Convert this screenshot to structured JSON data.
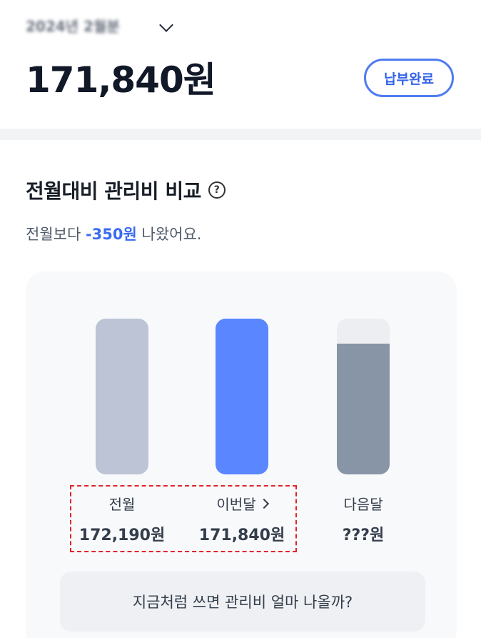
{
  "header": {
    "period_label": "2024년 2월분",
    "total_amount": "171,840원",
    "status_badge": "납부완료"
  },
  "comparison": {
    "title": "전월대비 관리비 비교",
    "subtitle_prefix": "전월보다 ",
    "subtitle_diff": "-350원",
    "subtitle_suffix": " 나왔어요."
  },
  "chart_data": {
    "type": "bar",
    "categories": [
      "전월",
      "이번달",
      "다음달"
    ],
    "values": [
      172190,
      171840,
      null
    ],
    "value_labels": [
      "172,190원",
      "171,840원",
      "???원"
    ],
    "bar_colors": [
      "#bcc4d6",
      "#5a86ff",
      "#8895a7"
    ],
    "next_bar_fill_fraction": 0.84
  },
  "estimate_button_label": "지금처럼 쓰면 관리비 얼마 나올까?",
  "colors": {
    "accent": "#3b6cf0",
    "highlight_border": "#e0262b"
  }
}
